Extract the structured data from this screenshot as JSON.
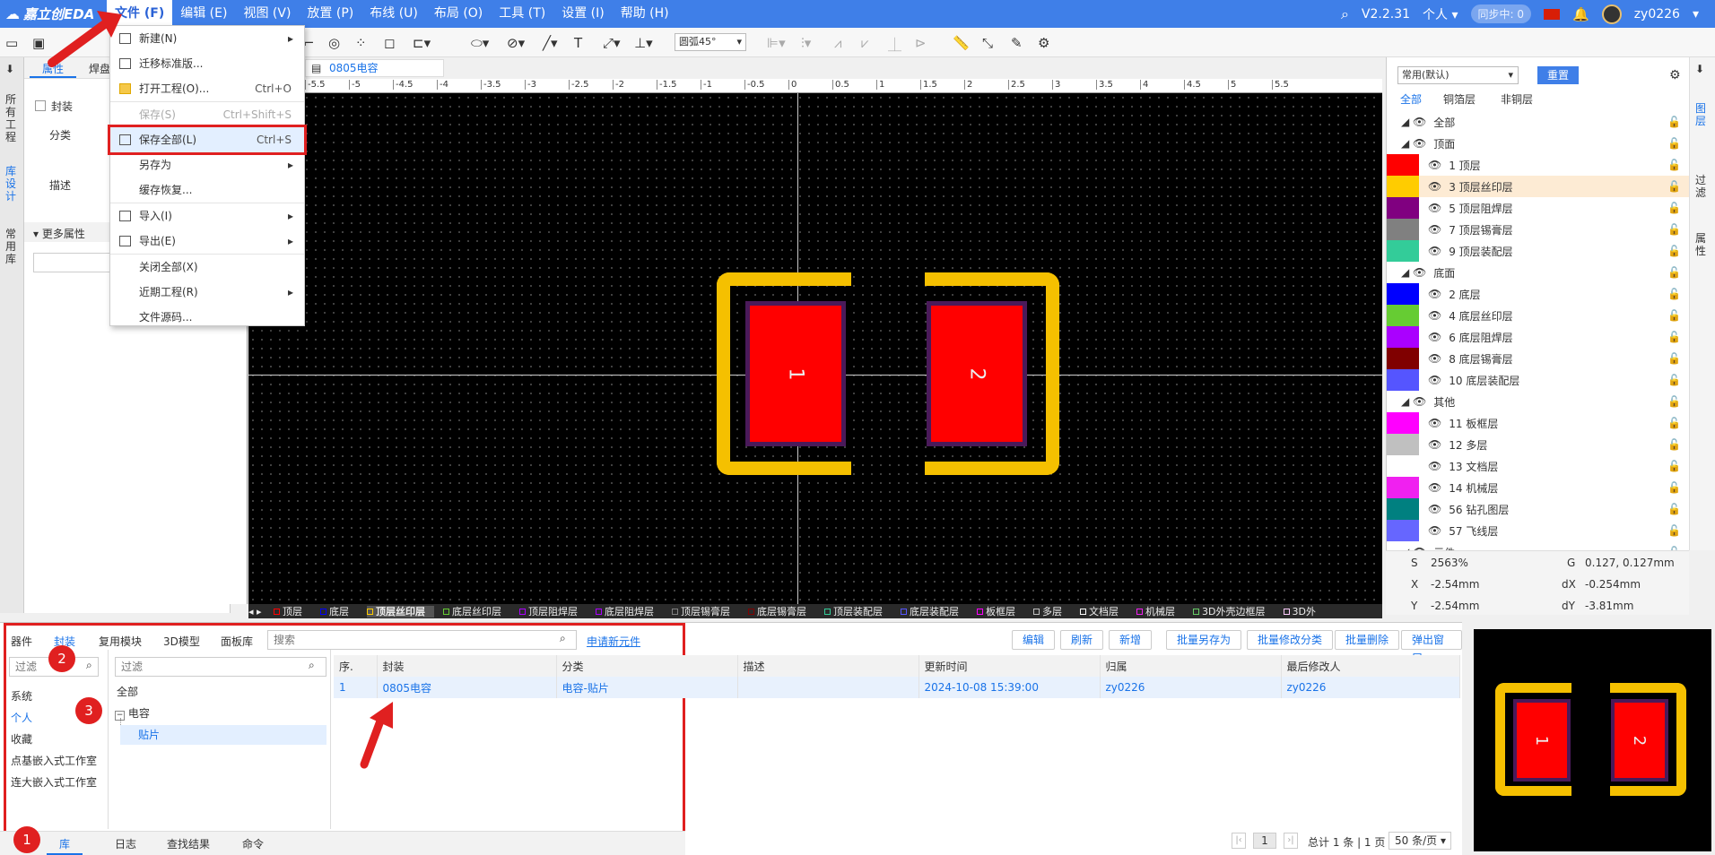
{
  "app": {
    "logo": "嘉立创EDA",
    "version": "V2.2.31",
    "workspace": "个人",
    "sync": "同步中: 0",
    "user": "zy0226"
  },
  "menu": [
    "文件 (F)",
    "编辑 (E)",
    "视图 (V)",
    "放置 (P)",
    "布线 (U)",
    "布局 (O)",
    "工具 (T)",
    "设置 (I)",
    "帮助 (H)"
  ],
  "toolbar": {
    "arc_select": "圆弧45°"
  },
  "file_menu": {
    "new": "新建(N)",
    "migrate": "迁移标准版...",
    "open": "打开工程(O)...",
    "open_sc": "Ctrl+O",
    "save": "保存(S)",
    "save_sc": "Ctrl+Shift+S",
    "save_all": "保存全部(L)",
    "save_all_sc": "Ctrl+S",
    "save_as": "另存为",
    "cache": "缓存恢复...",
    "import": "导入(I)",
    "export": "导出(E)",
    "close_all": "关闭全部(X)",
    "recent": "近期工程(R)",
    "source": "文件源码..."
  },
  "left_strip": [
    "所有工程",
    "库设计",
    "常用库"
  ],
  "props": {
    "tab1": "属性",
    "tab2": "焊盘",
    "footprint": "封装",
    "category": "分类",
    "desc": "描述",
    "more": "更多属性"
  },
  "doc_tab": "0805电容",
  "ruler_labels": [
    "-5.5",
    "-5",
    "-4.5",
    "-4",
    "-3.5",
    "-3",
    "-2.5",
    "-2",
    "-1.5",
    "-1",
    "-0.5",
    "0",
    "0.5",
    "1",
    "1.5",
    "2",
    "2.5",
    "3",
    "3.5",
    "4",
    "4.5",
    "5",
    "5.5"
  ],
  "pads": [
    "1",
    "2"
  ],
  "layer_bar": [
    "顶层",
    "底层",
    "顶层丝印层",
    "底层丝印层",
    "顶层阻焊层",
    "底层阻焊层",
    "顶层锡膏层",
    "底层锡膏层",
    "顶层装配层",
    "底层装配层",
    "板框层",
    "多层",
    "文档层",
    "机械层",
    "3D外壳边框层",
    "3D外"
  ],
  "layers_panel": {
    "preset": "常用(默认)",
    "reset": "重置",
    "tabs": [
      "全部",
      "铜箔层",
      "非铜层"
    ],
    "rows": [
      {
        "name": "全部",
        "color": ""
      },
      {
        "name": "顶面",
        "color": ""
      },
      {
        "name": "1 顶层",
        "color": "#ff0000"
      },
      {
        "name": "3 顶层丝印层",
        "color": "#ffcc00"
      },
      {
        "name": "5 顶层阻焊层",
        "color": "#800080"
      },
      {
        "name": "7 顶层锡膏层",
        "color": "#808080"
      },
      {
        "name": "9 顶层装配层",
        "color": "#33cc99"
      },
      {
        "name": "底面",
        "color": ""
      },
      {
        "name": "2 底层",
        "color": "#0000ff"
      },
      {
        "name": "4 底层丝印层",
        "color": "#66cc33"
      },
      {
        "name": "6 底层阻焊层",
        "color": "#aa00ff"
      },
      {
        "name": "8 底层锡膏层",
        "color": "#800000"
      },
      {
        "name": "10 底层装配层",
        "color": "#5555ff"
      },
      {
        "name": "其他",
        "color": ""
      },
      {
        "name": "11 板框层",
        "color": "#ff00ff"
      },
      {
        "name": "12 多层",
        "color": "#c0c0c0"
      },
      {
        "name": "13 文档层",
        "color": "#ffffff"
      },
      {
        "name": "14 机械层",
        "color": "#f020f0"
      },
      {
        "name": "56 钻孔图层",
        "color": "#008080"
      },
      {
        "name": "57 飞线层",
        "color": "#6666ff"
      },
      {
        "name": "元件",
        "color": ""
      }
    ],
    "right_strip": [
      "图层",
      "过滤",
      "属性"
    ]
  },
  "status": {
    "s_label": "S",
    "s_val": "2563%",
    "g_label": "G",
    "g_val": "0.127, 0.127mm",
    "x_label": "X",
    "x_val": "-2.54mm",
    "dx_label": "dX",
    "dx_val": "-0.254mm",
    "y_label": "Y",
    "y_val": "-2.54mm",
    "dy_label": "dY",
    "dy_val": "-3.81mm"
  },
  "bottom": {
    "tabs": [
      "器件",
      "封装",
      "复用模块",
      "3D模型",
      "面板库"
    ],
    "search_placeholder": "搜索",
    "request": "申请新元件",
    "actions": [
      "编辑",
      "刷新",
      "新增",
      "批量另存为",
      "批量修改分类",
      "批量删除",
      "弹出窗口"
    ],
    "filter_placeholder": "过滤",
    "sources": [
      "系统",
      "个人",
      "收藏",
      "点基嵌入式工作室",
      "连大嵌入式工作室"
    ],
    "tree_all": "全部",
    "tree_parent": "电容",
    "tree_child": "贴片",
    "columns": [
      "序.",
      "封装",
      "分类",
      "描述",
      "更新时间",
      "归属",
      "最后修改人"
    ],
    "rows": [
      {
        "idx": "1",
        "name": "0805电容",
        "cat": "电容-贴片",
        "desc": "",
        "time": "2024-10-08 15:39:00",
        "owner": "zy0226",
        "editor": "zy0226"
      }
    ],
    "bottom_tabs": [
      "库",
      "日志",
      "查找结果",
      "命令"
    ],
    "page": "1",
    "total": "总计 1 条 | 1 页",
    "per_page": "50 条/页"
  },
  "badges": [
    "1",
    "2",
    "3"
  ],
  "colors": {
    "accent": "#3f7fe8",
    "pad": "#ff0000",
    "silk": "#f5c000",
    "annotation": "#e02020"
  }
}
